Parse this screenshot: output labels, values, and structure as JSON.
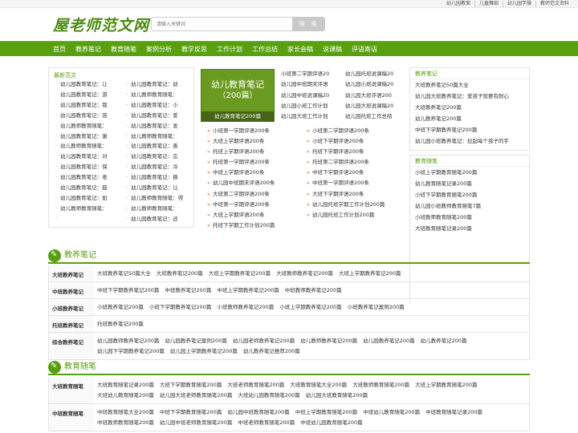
{
  "top_links": [
    "幼儿园教案",
    "儿童舞蹈",
    "幼儿园学操",
    "教师范文资料"
  ],
  "logo": "屋老师范文网",
  "search": {
    "placeholder": "请输入关键词",
    "button": "搜 索"
  },
  "nav": [
    "首页",
    "教养笔记",
    "教育随笔",
    "案例分析",
    "教学反思",
    "工作计划",
    "工作总结",
    "家长会稿",
    "说课稿",
    "评语寄语"
  ],
  "latest": {
    "title": "最新范文",
    "col1": [
      "幼儿园教育笔记：让",
      "幼儿园教育笔记：游",
      "幼儿园教育笔记：我",
      "幼儿园教育笔记：孩",
      "幼儿教师教育随笔：",
      "幼儿园教育笔记：谢",
      "幼儿教师教育随笔：",
      "幼儿园教育笔记：对",
      "幼儿园教育笔记：保",
      "幼儿园教育笔记：老",
      "幼儿园教育笔记：鼓",
      "幼儿园教育笔记：如",
      "幼儿教师教育随笔："
    ],
    "col2": [
      "幼儿园教育笔记：幼",
      "幼儿教师教育随笔：",
      "幼儿园教育笔记：小",
      "幼儿园教育笔记：爱",
      "幼儿园教育笔记：发",
      "幼儿教师教育随笔：",
      "幼儿园教育笔记：善",
      "幼儿园教育笔记：忘",
      "幼儿园教育笔记：冷",
      "幼儿园教育笔记：换",
      "幼儿园教育笔记：让",
      "幼儿教师教育随笔：得",
      "幼儿教师教育随笔：",
      "幼儿园教育笔记：适"
    ]
  },
  "promo": {
    "line1": "幼儿教育笔记",
    "line2": "（200篇）",
    "caption": "幼儿教育笔记200篇"
  },
  "mid_top": [
    "小班第二学期评语20",
    "幼儿园托班说课稿20",
    "幼儿园中班期末评语",
    "幼儿园小班说课稿20",
    "幼儿园中班说课稿20",
    "幼儿园大班评语200",
    "幼儿园小班工作计划",
    "幼儿园大班说课稿20",
    "幼儿园大班工作计划",
    "幼儿园托班工作总结"
  ],
  "mid_bottom": [
    "小班第一学期评语200条",
    "小班第二学期评语200条",
    "大班上学期评语200条",
    "小班下学期评语200条",
    "托班上学期评语200条",
    "托班下学期评语200条",
    "托班第一学期评语200条",
    "托班第二学期评语200条",
    "中班上学期评语200条",
    "中班下学期评语200条",
    "幼儿园中班期末评语200条",
    "中班第一学期评语200条",
    "大班第二学期评语200条",
    "大班下学期评语200条",
    "中班第一学期评语200条",
    "幼儿园托班学期工作计划200篇",
    "大班上学期评语200条",
    "幼儿园托班工作计划200篇",
    "托班下学期工作计划200篇"
  ],
  "right": {
    "title1": "教养笔记",
    "list1": [
      "大班教养笔记50篇大全",
      "幼儿园大班教养笔记：爱孩子就要有耐心",
      "大班教养笔记200篇",
      "幼儿教养笔记200篇",
      "中班下学期教养笔记200篇",
      "幼儿园小班教养笔记：拉起每个孩子的手"
    ],
    "title2": "教育随笔",
    "list2": [
      "小班上学期教育随笔200篇",
      "幼儿教育随笔记录200篇",
      "小班下学期教育随笔200篇",
      "幼儿园小班教师教育随笔7篇",
      "小班教师教育随笔200篇",
      "大班教育随笔记录200篇"
    ]
  },
  "section1": {
    "title": "教养笔记",
    "rows": [
      {
        "label": "大班教养笔记",
        "links": [
          "大班教养笔记50篇大全",
          "大班教养笔记200篇",
          "大班上学期教养笔记200篇",
          "大班教师教养笔记200篇",
          "大班上学期教养笔记200篇"
        ]
      },
      {
        "label": "中班教养笔记",
        "links": [
          "中班下学期教养笔记200篇",
          "中班教养笔记200篇",
          "中班上学期教养笔记200篇",
          "中班教师教养笔记200篇"
        ]
      },
      {
        "label": "小班教养笔记",
        "links": [
          "小班教养笔记200篇",
          "小班下学期教养笔记200篇",
          "小班教师教养笔记200篇",
          "小班上学期教养笔记200篇",
          "小班教养笔记案例200篇"
        ]
      },
      {
        "label": "托班教养笔记",
        "links": [
          "托班教养笔记200篇"
        ]
      },
      {
        "label": "综合教养笔记",
        "links": [
          "幼儿园教师教养笔记200篇",
          "幼儿园教养笔记案例200篇",
          "幼儿园老师教养笔记200篇",
          "幼儿教师教养笔记200篇",
          "幼儿园教养笔记200篇",
          "幼儿教养笔记200篇",
          "幼儿园下学期教养笔记200篇",
          "幼儿园上学期教养笔记200篇",
          "幼儿教养笔记推荐200篇"
        ]
      }
    ]
  },
  "section2": {
    "title": "教育随笔",
    "rows": [
      {
        "label": "大班教育随笔",
        "links": [
          "大班教育随笔记录200篇",
          "大班下学期教育随笔200篇",
          "大班老师教育随笔200篇",
          "大班教育随笔大全200篇",
          "大班教师教育随笔200篇",
          "大班上学期教育随笔200篇",
          "大班幼儿教育随笔200篇",
          "幼儿园大班老师教育随笔200篇",
          "大班幼儿园教育随笔200篇",
          "幼儿园大班教育随笔200篇"
        ]
      },
      {
        "label": "中班教育随笔",
        "links": [
          "中班教育随笔大全200篇",
          "中班下学期教育随笔200篇",
          "幼儿园中班教育随笔200篇",
          "中班上学期教育随笔200篇",
          "中班幼儿教育随笔200篇",
          "中班教育随笔记录200篇",
          "中班教师教育随笔200篇",
          "幼儿园中班老师教育随笔200篇",
          "中班老师教育随笔200篇",
          "中班幼儿园教育随笔200篇"
        ]
      }
    ]
  }
}
